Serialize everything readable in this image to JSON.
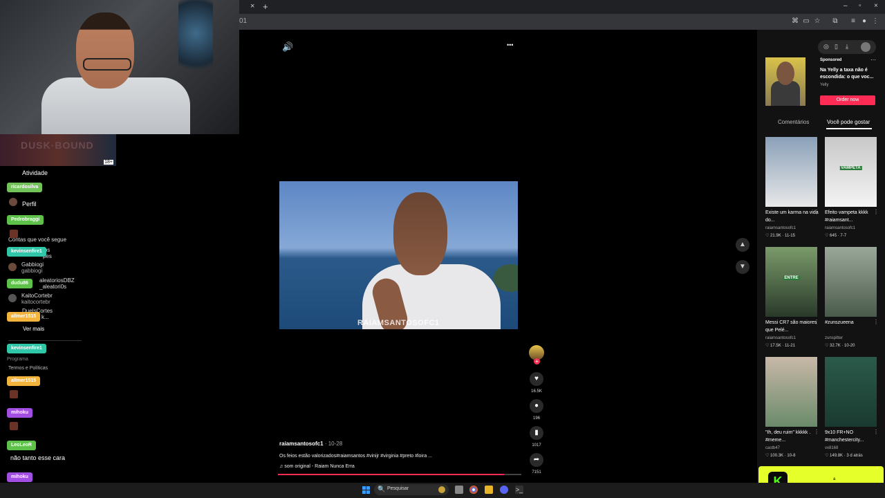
{
  "browser": {
    "tab_close": "×",
    "new_tab": "+",
    "url_fragment": "01",
    "window_controls": [
      "–",
      "▫",
      "×"
    ]
  },
  "sidebar": {
    "activity_label": "Atividade",
    "profile_label": "Perfil",
    "following_header": "Contas que você segue",
    "accounts": [
      {
        "name": "Gabbiogi",
        "handle": "gabbiogi"
      },
      {
        "name": "KaitoCortebr",
        "handle": "kaitocortebr"
      }
    ],
    "partial_lines": [
      "ips",
      "pes",
      "aleatoriosDBZ",
      "_aleatori0s",
      "DuelsCortes",
      "k..."
    ],
    "see_more": "Ver mais",
    "footer_program": "Programa",
    "footer_terms": "Termos e Políticas"
  },
  "chat": {
    "usernames": [
      {
        "name": "ricardosilva",
        "color": "#72c45a"
      },
      {
        "name": "Pedrobraggi",
        "color": "#5ec24a"
      },
      {
        "name": "kevinsenfire1",
        "color": "#2fc7a8"
      },
      {
        "name": "dudu86",
        "color": "#5ec24a"
      },
      {
        "name": "allmer1515",
        "color": "#f2b43d"
      },
      {
        "name": "kevinsenfire1",
        "color": "#2fc7a8"
      },
      {
        "name": "allmer1515",
        "color": "#f2b43d"
      },
      {
        "name": "mihoku",
        "color": "#a34ee3"
      },
      {
        "name": "LeoLeoR",
        "color": "#5ec24a"
      },
      {
        "name": "mihoku",
        "color": "#a34ee3"
      }
    ],
    "message": "não tanto esse cara"
  },
  "video": {
    "watermark": "RAIAMSANTOSOFC1",
    "volume_icon": "🔊",
    "more_icon": "•••",
    "username": "raiamsantosofc1",
    "date": "10-28",
    "description": "Os feios estão valorizados#raiamsantos #vinijr #virginia #preto #loira ...",
    "sound": "som original - Raiam Nunca Erra",
    "progress": 0.93,
    "likes": "16.5K",
    "comments": "196",
    "saves": "1017",
    "shares": "7151"
  },
  "right_panel": {
    "ad": {
      "sponsored": "Sponsored",
      "title": "Na Yelly a taxa não é escondida: o que voc...",
      "brand": "Yelly",
      "cta": "Order now"
    },
    "tabs": [
      "Comentários",
      "Você pode gostar"
    ],
    "recommendations": [
      {
        "title": "Existe um karma na vida do...",
        "author": "raiamsantosofc1",
        "stats": "♡ 21.9K · 11-15",
        "thumb_top": "#8aa0b8",
        "thumb_bottom": "#e8e8e8"
      },
      {
        "title": "Efeito vampeta kkkk #raiamsant...",
        "author": "raiamsantosofc1",
        "stats": "♡ 645 · 7-7",
        "thumb_top": "#c8c8c8",
        "thumb_bottom": "#f4f4f4",
        "badge": "VAMPETA"
      },
      {
        "title": "Messi CR7 são maiores que Pelé...",
        "author": "raiamsantosofc1",
        "stats": "♡ 17.5K · 11-21",
        "thumb_top": "#7a9a6a",
        "thumb_bottom": "#2a3a2a",
        "badge": "ENTRE"
      },
      {
        "title": "#zunszueena",
        "author": "zunspitter",
        "stats": "♡ 32.7K · 10-20",
        "thumb_top": "#9aa89a",
        "thumb_bottom": "#4a5a4a"
      },
      {
        "title": "\"Ih, deu ruim\" kkkkk . #meme...",
        "author": "castb47",
        "stats": "♡ 100.3K · 10-8",
        "thumb_top": "#c8b8a8",
        "thumb_bottom": "#6a8a6a"
      },
      {
        "title": "9x10 FR+NO #manchestercity...",
        "author": "vx8168",
        "stats": "♡ 149.8K · 3 d atrás",
        "thumb_top": "#2a5a4a",
        "thumb_bottom": "#1a3a30"
      }
    ]
  },
  "kick": {
    "logo": "K",
    "dot": "a"
  },
  "taskbar": {
    "search_placeholder": "Pesquisar",
    "search_icon": "🔍"
  }
}
